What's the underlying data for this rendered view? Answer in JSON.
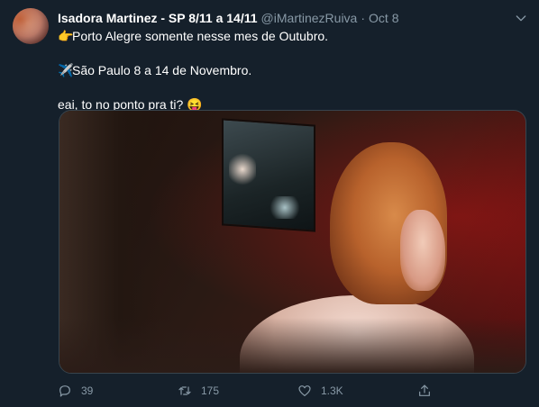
{
  "tweet": {
    "display_name": "Isadora Martinez - SP 8/11 a 14/11",
    "handle": "@iMartinezRuiva",
    "separator": "·",
    "date": "Oct 8",
    "lines": [
      {
        "emoji": "👉",
        "text": "Porto Alegre somente nesse mes de Outubro."
      },
      {
        "emoji": "✈️",
        "text": "São Paulo 8 a 14 de Novembro."
      },
      {
        "emoji": "😝",
        "text": "eai, to no ponto pra ti?"
      }
    ]
  },
  "actions": {
    "replies": "39",
    "retweets": "175",
    "likes": "1.3K"
  },
  "colors": {
    "background": "#15202b",
    "secondary_text": "#8899a6",
    "border": "#38444d"
  }
}
